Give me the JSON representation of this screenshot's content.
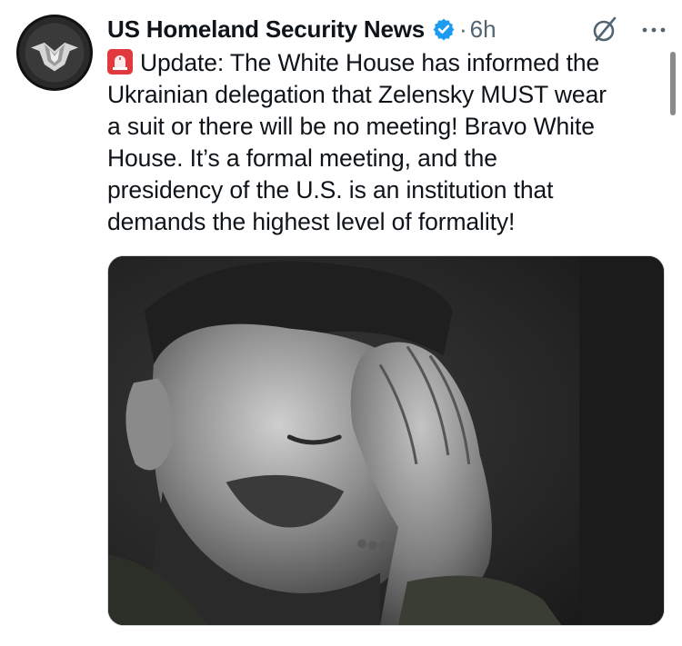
{
  "tweet": {
    "author": {
      "display_name": "US Homeland Security News",
      "verified": true,
      "avatar_icon": "shield-eagle-logo"
    },
    "separator": "·",
    "timestamp": "6h",
    "text_prefix_icon": "rotating-light-emoji",
    "text": "Update: The White House has informed the\nUkrainian delegation that Zelensky MUST wear\na suit or there will be no meeting! Bravo White\nHouse. It’s a formal meeting, and the\npresidency of the U.S. is an institution that\ndemands the highest level of formality!",
    "media": {
      "kind": "photo"
    }
  },
  "actions": {
    "grok_icon": "grok-icon",
    "more_icon": "more-options-icon"
  },
  "colors": {
    "text_primary": "#0f1419",
    "text_secondary": "#536471",
    "verified_blue": "#1d9bf0",
    "siren_red": "#e03a3e"
  }
}
